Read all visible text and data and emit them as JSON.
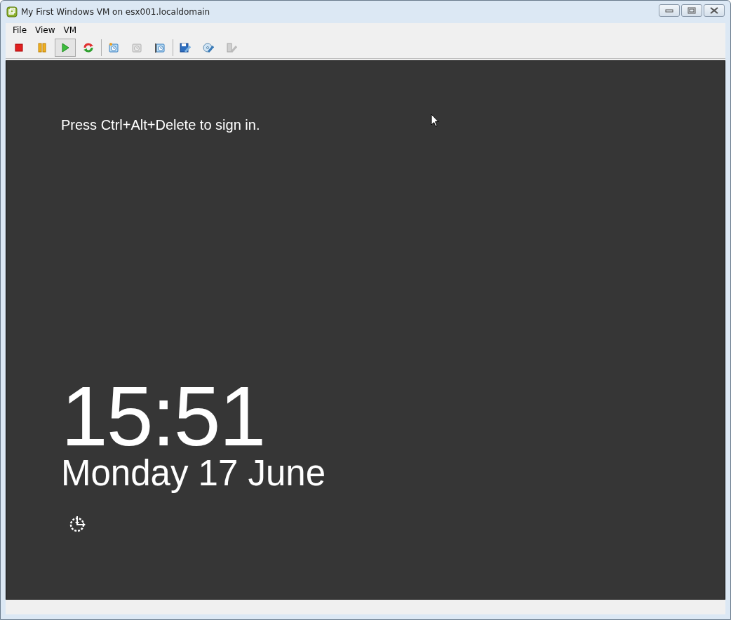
{
  "window": {
    "title": "My First Windows VM on esx001.localdomain"
  },
  "menu": [
    "File",
    "View",
    "VM"
  ],
  "toolbar": [
    {
      "kind": "stop",
      "pressed": false,
      "disabled": false
    },
    {
      "kind": "pause",
      "pressed": false,
      "disabled": false
    },
    {
      "kind": "play",
      "pressed": true,
      "disabled": false
    },
    {
      "kind": "reset",
      "pressed": false,
      "disabled": false
    },
    {
      "kind": "separator"
    },
    {
      "kind": "snapshot-take",
      "pressed": false,
      "disabled": false
    },
    {
      "kind": "snapshot-revert",
      "pressed": false,
      "disabled": true
    },
    {
      "kind": "snapshot-manage",
      "pressed": false,
      "disabled": false
    },
    {
      "kind": "separator"
    },
    {
      "kind": "floppy-edit",
      "pressed": false,
      "disabled": false
    },
    {
      "kind": "cd-edit",
      "pressed": false,
      "disabled": false
    },
    {
      "kind": "usb-edit",
      "pressed": false,
      "disabled": true
    }
  ],
  "console": {
    "prompt": "Press Ctrl+Alt+Delete to sign in.",
    "time": "15:51",
    "date": "Monday 17 June"
  }
}
